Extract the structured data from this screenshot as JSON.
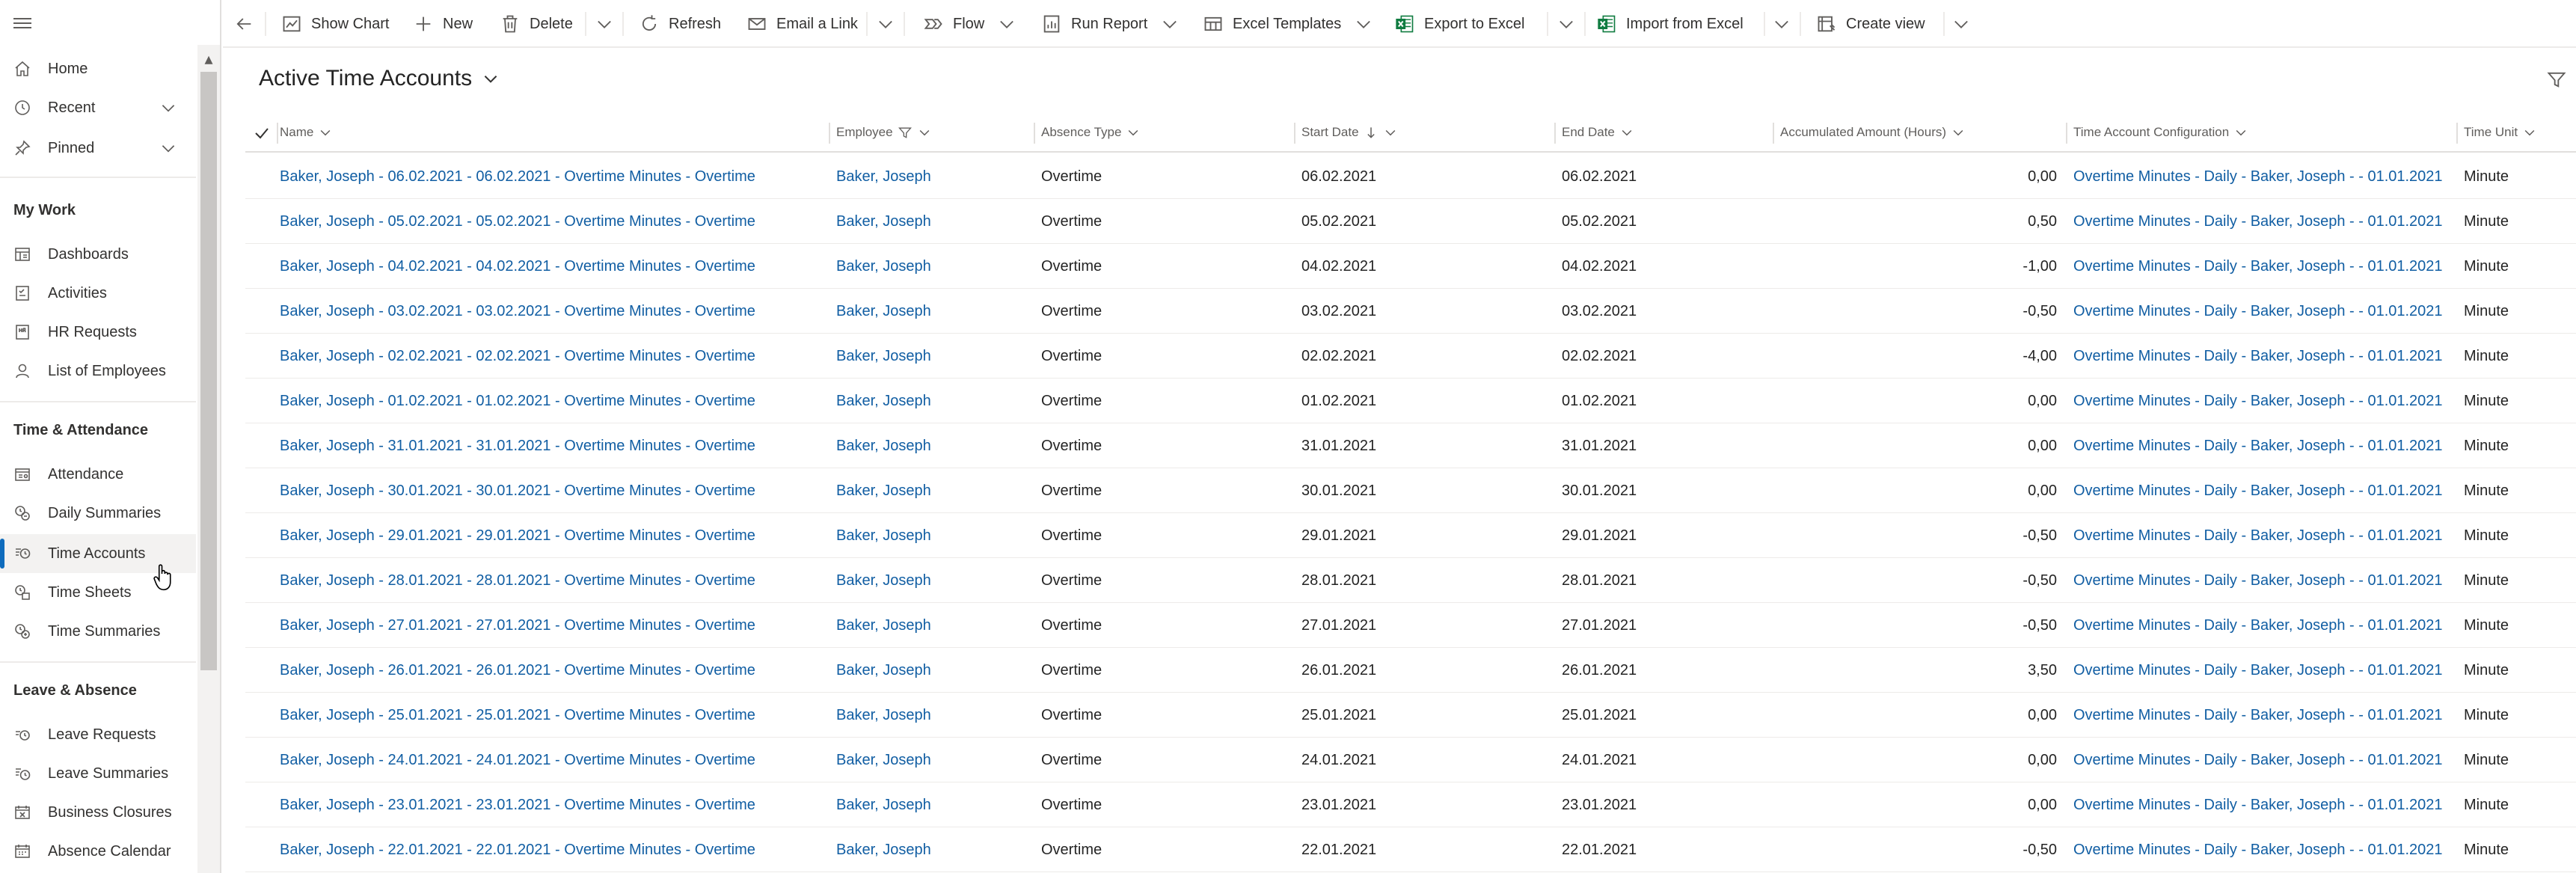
{
  "sidebar": {
    "items_top": [
      {
        "label": "Home",
        "icon": "home-icon"
      },
      {
        "label": "Recent",
        "icon": "clock-icon"
      },
      {
        "label": "Pinned",
        "icon": "pin-icon"
      }
    ],
    "groups": [
      {
        "title": "My Work",
        "items": [
          {
            "label": "Dashboards",
            "icon": "dashboard-icon"
          },
          {
            "label": "Activities",
            "icon": "activities-icon"
          },
          {
            "label": "HR Requests",
            "icon": "hr-request-icon"
          },
          {
            "label": "List of Employees",
            "icon": "person-icon"
          }
        ]
      },
      {
        "title": "Time & Attendance",
        "items": [
          {
            "label": "Attendance",
            "icon": "attendance-icon"
          },
          {
            "label": "Daily Summaries",
            "icon": "daily-summaries-icon"
          },
          {
            "label": "Time Accounts",
            "icon": "time-accounts-icon",
            "selected": true
          },
          {
            "label": "Time Sheets",
            "icon": "time-sheets-icon"
          },
          {
            "label": "Time Summaries",
            "icon": "time-summaries-icon"
          }
        ]
      },
      {
        "title": "Leave & Absence",
        "items": [
          {
            "label": "Leave Requests",
            "icon": "leave-requests-icon"
          },
          {
            "label": "Leave Summaries",
            "icon": "leave-summaries-icon"
          },
          {
            "label": "Business Closures",
            "icon": "business-closures-icon"
          },
          {
            "label": "Absence Calendar",
            "icon": "calendar-icon"
          }
        ]
      }
    ]
  },
  "commandbar": {
    "show_chart": "Show Chart",
    "new": "New",
    "delete": "Delete",
    "refresh": "Refresh",
    "email_link": "Email a Link",
    "flow": "Flow",
    "run_report": "Run Report",
    "excel_templates": "Excel Templates",
    "export_excel": "Export to Excel",
    "import_excel": "Import from Excel",
    "create_view": "Create view"
  },
  "view": {
    "title": "Active Time Accounts"
  },
  "grid": {
    "columns": {
      "name": "Name",
      "employee": "Employee",
      "absence_type": "Absence Type",
      "start_date": "Start Date",
      "end_date": "End Date",
      "accumulated": "Accumulated Amount (Hours)",
      "config": "Time Account Configuration",
      "unit": "Time Unit"
    },
    "rows": [
      {
        "name": "Baker, Joseph  - 06.02.2021 - 06.02.2021 - Overtime Minutes - Overtime",
        "employee": "Baker, Joseph",
        "absence_type": "Overtime",
        "start": "06.02.2021",
        "end": "06.02.2021",
        "amount": "0,00",
        "config": "Overtime Minutes - Daily - Baker, Joseph  -  - 01.01.2021",
        "unit": "Minute"
      },
      {
        "name": "Baker, Joseph  - 05.02.2021 - 05.02.2021 - Overtime Minutes - Overtime",
        "employee": "Baker, Joseph",
        "absence_type": "Overtime",
        "start": "05.02.2021",
        "end": "05.02.2021",
        "amount": "0,50",
        "config": "Overtime Minutes - Daily - Baker, Joseph  -  - 01.01.2021",
        "unit": "Minute"
      },
      {
        "name": "Baker, Joseph  - 04.02.2021 - 04.02.2021 - Overtime Minutes - Overtime",
        "employee": "Baker, Joseph",
        "absence_type": "Overtime",
        "start": "04.02.2021",
        "end": "04.02.2021",
        "amount": "-1,00",
        "config": "Overtime Minutes - Daily - Baker, Joseph  -  - 01.01.2021",
        "unit": "Minute"
      },
      {
        "name": "Baker, Joseph  - 03.02.2021 - 03.02.2021 - Overtime Minutes - Overtime",
        "employee": "Baker, Joseph",
        "absence_type": "Overtime",
        "start": "03.02.2021",
        "end": "03.02.2021",
        "amount": "-0,50",
        "config": "Overtime Minutes - Daily - Baker, Joseph  -  - 01.01.2021",
        "unit": "Minute"
      },
      {
        "name": "Baker, Joseph  - 02.02.2021 - 02.02.2021 - Overtime Minutes - Overtime",
        "employee": "Baker, Joseph",
        "absence_type": "Overtime",
        "start": "02.02.2021",
        "end": "02.02.2021",
        "amount": "-4,00",
        "config": "Overtime Minutes - Daily - Baker, Joseph  -  - 01.01.2021",
        "unit": "Minute"
      },
      {
        "name": "Baker, Joseph  - 01.02.2021 - 01.02.2021 - Overtime Minutes - Overtime",
        "employee": "Baker, Joseph",
        "absence_type": "Overtime",
        "start": "01.02.2021",
        "end": "01.02.2021",
        "amount": "0,00",
        "config": "Overtime Minutes - Daily - Baker, Joseph  -  - 01.01.2021",
        "unit": "Minute"
      },
      {
        "name": "Baker, Joseph  - 31.01.2021 - 31.01.2021 - Overtime Minutes - Overtime",
        "employee": "Baker, Joseph",
        "absence_type": "Overtime",
        "start": "31.01.2021",
        "end": "31.01.2021",
        "amount": "0,00",
        "config": "Overtime Minutes - Daily - Baker, Joseph  -  - 01.01.2021",
        "unit": "Minute"
      },
      {
        "name": "Baker, Joseph  - 30.01.2021 - 30.01.2021 - Overtime Minutes - Overtime",
        "employee": "Baker, Joseph",
        "absence_type": "Overtime",
        "start": "30.01.2021",
        "end": "30.01.2021",
        "amount": "0,00",
        "config": "Overtime Minutes - Daily - Baker, Joseph  -  - 01.01.2021",
        "unit": "Minute"
      },
      {
        "name": "Baker, Joseph  - 29.01.2021 - 29.01.2021 - Overtime Minutes - Overtime",
        "employee": "Baker, Joseph",
        "absence_type": "Overtime",
        "start": "29.01.2021",
        "end": "29.01.2021",
        "amount": "-0,50",
        "config": "Overtime Minutes - Daily - Baker, Joseph  -  - 01.01.2021",
        "unit": "Minute"
      },
      {
        "name": "Baker, Joseph  - 28.01.2021 - 28.01.2021 - Overtime Minutes - Overtime",
        "employee": "Baker, Joseph",
        "absence_type": "Overtime",
        "start": "28.01.2021",
        "end": "28.01.2021",
        "amount": "-0,50",
        "config": "Overtime Minutes - Daily - Baker, Joseph  -  - 01.01.2021",
        "unit": "Minute"
      },
      {
        "name": "Baker, Joseph  - 27.01.2021 - 27.01.2021 - Overtime Minutes - Overtime",
        "employee": "Baker, Joseph",
        "absence_type": "Overtime",
        "start": "27.01.2021",
        "end": "27.01.2021",
        "amount": "-0,50",
        "config": "Overtime Minutes - Daily - Baker, Joseph  -  - 01.01.2021",
        "unit": "Minute"
      },
      {
        "name": "Baker, Joseph  - 26.01.2021 - 26.01.2021 - Overtime Minutes - Overtime",
        "employee": "Baker, Joseph",
        "absence_type": "Overtime",
        "start": "26.01.2021",
        "end": "26.01.2021",
        "amount": "3,50",
        "config": "Overtime Minutes - Daily - Baker, Joseph  -  - 01.01.2021",
        "unit": "Minute"
      },
      {
        "name": "Baker, Joseph  - 25.01.2021 - 25.01.2021 - Overtime Minutes - Overtime",
        "employee": "Baker, Joseph",
        "absence_type": "Overtime",
        "start": "25.01.2021",
        "end": "25.01.2021",
        "amount": "0,00",
        "config": "Overtime Minutes - Daily - Baker, Joseph  -  - 01.01.2021",
        "unit": "Minute"
      },
      {
        "name": "Baker, Joseph  - 24.01.2021 - 24.01.2021 - Overtime Minutes - Overtime",
        "employee": "Baker, Joseph",
        "absence_type": "Overtime",
        "start": "24.01.2021",
        "end": "24.01.2021",
        "amount": "0,00",
        "config": "Overtime Minutes - Daily - Baker, Joseph  -  - 01.01.2021",
        "unit": "Minute"
      },
      {
        "name": "Baker, Joseph  - 23.01.2021 - 23.01.2021 - Overtime Minutes - Overtime",
        "employee": "Baker, Joseph",
        "absence_type": "Overtime",
        "start": "23.01.2021",
        "end": "23.01.2021",
        "amount": "0,00",
        "config": "Overtime Minutes - Daily - Baker, Joseph  -  - 01.01.2021",
        "unit": "Minute"
      },
      {
        "name": "Baker, Joseph  - 22.01.2021 - 22.01.2021 - Overtime Minutes - Overtime",
        "employee": "Baker, Joseph",
        "absence_type": "Overtime",
        "start": "22.01.2021",
        "end": "22.01.2021",
        "amount": "-0,50",
        "config": "Overtime Minutes - Daily - Baker, Joseph  -  - 01.01.2021",
        "unit": "Minute"
      }
    ]
  },
  "colors": {
    "accent": "#0f6cbd",
    "link": "#115ea3",
    "excel_green": "#107c41"
  }
}
